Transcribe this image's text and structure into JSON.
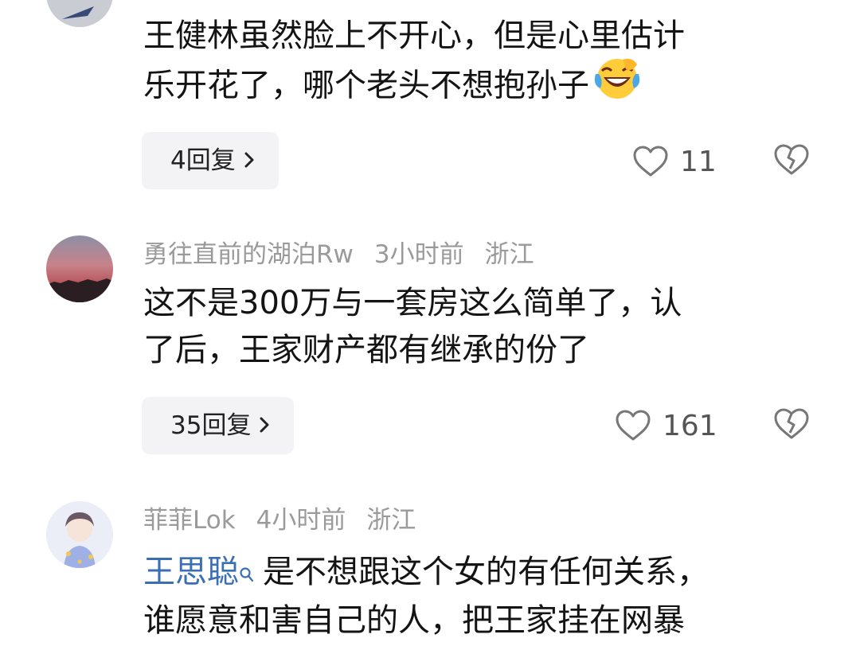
{
  "comments": [
    {
      "lines": [
        "王健林虽然脸上不开心，但是心里估计",
        "乐开花了，哪个老头不想抱孙子"
      ],
      "emoji": "laughing-crying-emoji",
      "replies": "4回复",
      "likes": "11"
    },
    {
      "user": "勇往直前的湖泊Rw",
      "time": "3小时前",
      "location": "浙江",
      "lines": [
        "这不是300万与一套房这么简单了，认",
        "了后，王家财产都有继承的份了"
      ],
      "replies": "35回复",
      "likes": "161"
    },
    {
      "user": "菲菲Lok",
      "time": "4小时前",
      "location": "浙江",
      "mention": "王思聪",
      "line1_rest": "是不想跟这个女的有任何关系，",
      "line2": "谁愿意和害自己的人，把王家挂在网暴"
    }
  ],
  "icons": {
    "like": "heart-outline-icon",
    "dislike": "broken-heart-icon",
    "reply_chevron": "chevron-right-icon",
    "mention": "search-icon"
  },
  "colors": {
    "mention": "#3b6fb4",
    "meta": "#9a9a9a",
    "reply_bg": "#f3f3f5"
  }
}
